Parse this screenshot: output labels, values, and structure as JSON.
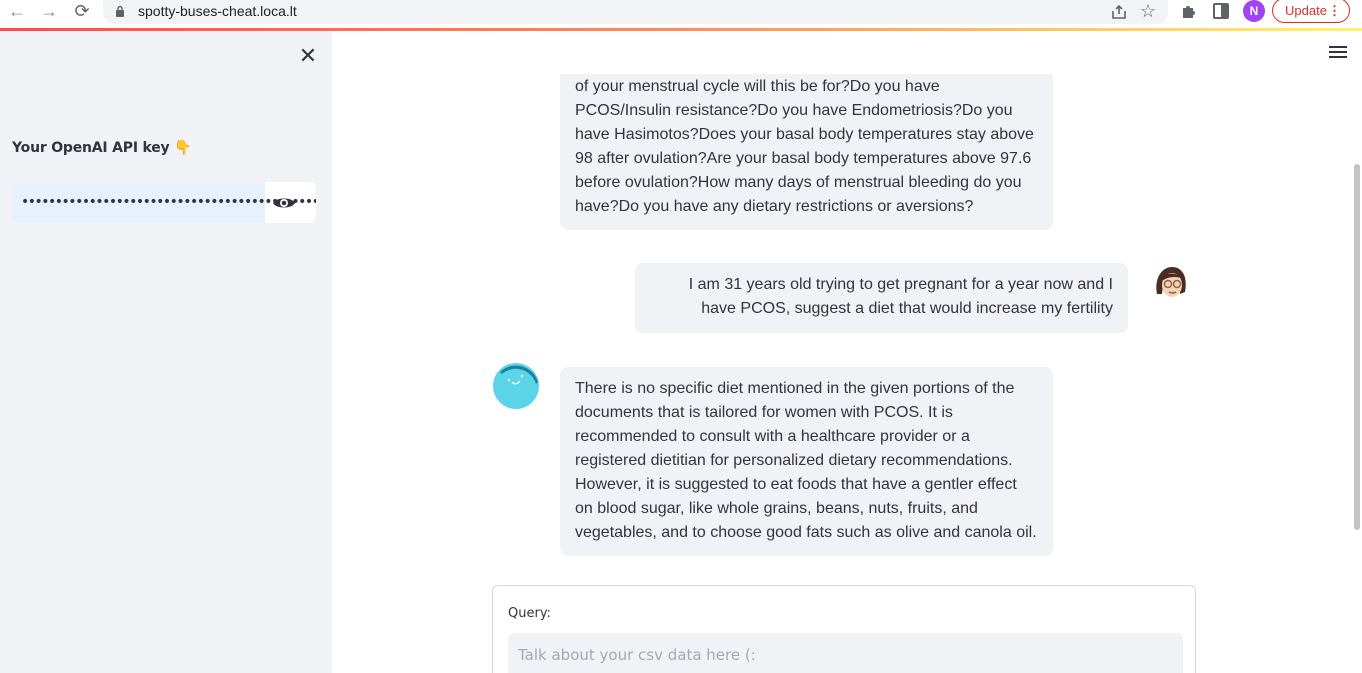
{
  "browser": {
    "url": "spotty-buses-cheat.loca.lt",
    "profile_initial": "N",
    "update_label": "Update",
    "update_dots": "⋮"
  },
  "sidebar": {
    "close_glyph": "✕",
    "api_key_label": "Your OpenAI API key",
    "api_key_emoji": "👇",
    "api_key_masked": "••••••••••••••••••••••••••••••••••••••••••••••••••"
  },
  "chat": {
    "messages": [
      {
        "role": "assistant",
        "text": "of your menstrual cycle will this be for?Do you have PCOS/Insulin resistance?Do you have Endometriosis?Do you have Hasimotos?Does your basal body temperatures stay above 98 after ovulation?Are your basal body temperatures above 97.6 before ovulation?How many days of menstrual bleeding do you have?Do you have any dietary restrictions or aversions?"
      },
      {
        "role": "user",
        "text": "I am 31 years old trying to get pregnant for a year now and I have PCOS, suggest a diet that would increase my fertility"
      },
      {
        "role": "assistant",
        "text": "There is no specific diet mentioned in the given portions of the documents that is tailored for women with PCOS. It is recommended to consult with a healthcare provider or a registered dietitian for personalized dietary recommendations. However, it is suggested to eat foods that have a gentler effect on blood sugar, like whole grains, beans, nuts, fruits, and vegetables, and to choose good fats such as olive and canola oil."
      }
    ]
  },
  "query": {
    "label": "Query:",
    "placeholder": "Talk about your csv data here (:"
  },
  "colors": {
    "sidebar_bg": "#f0f2f6",
    "bubble_bg": "#f0f2f6",
    "update_red": "#d93025",
    "avatar_purple": "#a142f4",
    "bot_cyan": "#5bd4e8"
  }
}
